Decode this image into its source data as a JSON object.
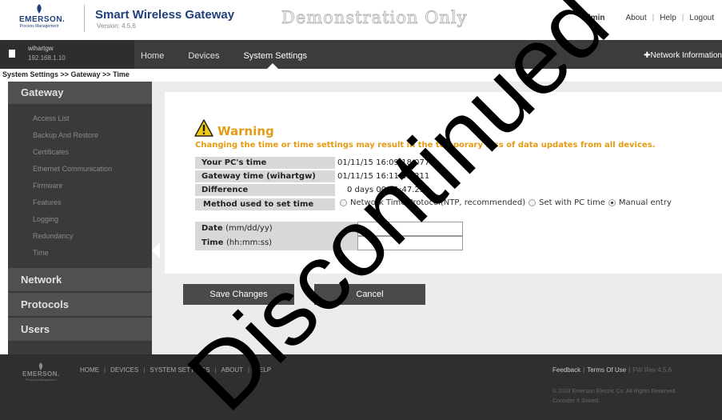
{
  "header": {
    "brand": "EMERSON.",
    "brand_sub": "Process Management",
    "app_title": "Smart Wireless Gateway",
    "version": "Version: 4.5.6",
    "demo_banner": "Demonstration Only",
    "user": "admin",
    "links": [
      "About",
      "Help",
      "Logout"
    ]
  },
  "nav": {
    "device_name": "wihartgw",
    "device_ip": "192.168.1.10",
    "items": [
      "Home",
      "Devices",
      "System Settings"
    ],
    "active": "System Settings",
    "network_info": "Network Information"
  },
  "breadcrumb": "System Settings >> Gateway >> Time",
  "sidebar": {
    "gateway_title": "Gateway",
    "gateway_items": [
      "Access List",
      "Backup And Restore",
      "Certificates",
      "Ethernet Communication",
      "Firmware",
      "Features",
      "Logging",
      "Redundancy",
      "Time"
    ],
    "selected": "Time",
    "sections": [
      "Network",
      "Protocols",
      "Users"
    ]
  },
  "warning": {
    "title": "Warning",
    "message": "Changing the time or time settings may result in the temporary loss of data updates from all devices."
  },
  "time_info": {
    "pc_time_label": "Your PC's time",
    "pc_time_value": "01/11/15 16:09:18.077",
    "gateway_time_label": "Gateway time (wihartgw)",
    "gateway_time_value": "01/11/15 16:11:05.311",
    "difference_label": "Difference",
    "difference_value": "0 days 00:01:47.234",
    "method_label": "Method used to set time",
    "method_options": [
      "Network Time Protocol(NTP, recommended)",
      "Set with PC time",
      "Manual entry"
    ],
    "method_selected": "Manual entry"
  },
  "manual": {
    "date_label": "Date",
    "date_units": "(mm/dd/yy)",
    "date_value": "",
    "time_label": "Time",
    "time_units": "(hh:mm:ss)",
    "time_value": ""
  },
  "buttons": {
    "save": "Save Changes",
    "cancel": "Cancel"
  },
  "footer": {
    "brand": "EMERSON.",
    "brand_sub": "Process Management",
    "links": [
      "HOME",
      "DEVICES",
      "SYSTEM SETTINGS",
      "ABOUT",
      "HELP"
    ],
    "feedback": "Feedback",
    "terms": "Terms Of Use",
    "fw_rev": "FW Rev 4.5.6",
    "copyright": "© 2013 Emerson Electric Co. All Rights Reserved.",
    "tagline": "Consider It Solved."
  },
  "watermark": "Discontinued",
  "colors": {
    "brand_blue": "#1f3f7a",
    "warning_orange": "#e39b13",
    "nav_dark": "#3c3c3c",
    "sidebar_dark": "#3a3a3a",
    "watermark": "#000000"
  }
}
